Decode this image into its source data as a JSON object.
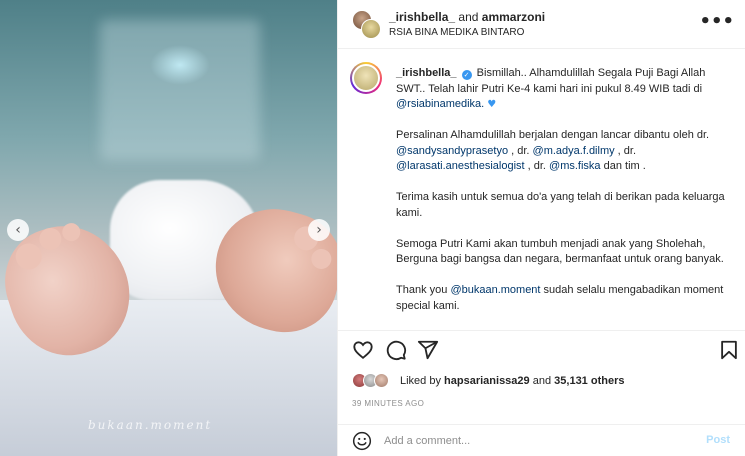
{
  "photo": {
    "watermark": "bukaan.moment",
    "nav_prev_glyph": "‹",
    "nav_next_glyph": "›"
  },
  "header": {
    "user1": "_irishbella_",
    "joiner": "and",
    "user2": "ammarzoni",
    "location": "RSIA BINA MEDIKA BINTARO",
    "more_glyph": "•••"
  },
  "caption": {
    "username": "_irishbella_",
    "verified_glyph": "✓",
    "line1_text": "Bismillah.. Alhamdulillah Segala Puji Bagi Allah SWT.. Telah lahir Putri Ke-4 kami hari ini pukul 8.49 WIB tadi di",
    "line1_mention": "@rsiabinamedika.",
    "heart_glyph": "♥",
    "p2_text": "Persalinan Alhamdulillah berjalan dengan lancar dibantu oleh dr.",
    "p2_m1": "@sandysandyprasetyo",
    "p2_sep1": ", dr.",
    "p2_m2": "@m.adya.f.dilmy",
    "p2_sep2": ", dr.",
    "p2_m3": "@larasati.anesthesialogist",
    "p2_sep3": ", dr.",
    "p2_m4": "@ms.fiska",
    "p2_end": "dan tim .",
    "p3": "Terima kasih untuk semua do'a yang telah di berikan pada keluarga kami.",
    "p4": "Semoga Putri Kami akan tumbuh menjadi anak yang Sholehah, Berguna bagi bangsa dan negara, bermanfaat untuk orang banyak.",
    "p5_start": "Thank you",
    "p5_mention": "@bukaan.moment",
    "p5_end": "sudah selalu mengabadikan moment special kami."
  },
  "likes": {
    "prefix": "Liked by",
    "first_liker": "hapsarianissa29",
    "joiner": "and",
    "count_text": "35,131 others"
  },
  "timestamp": "39 MINUTES AGO",
  "comment": {
    "placeholder": "Add a comment...",
    "post_label": "Post"
  },
  "colors": {
    "link": "#00376b",
    "verified": "#3897f0",
    "post_disabled": "#b2dffc",
    "muted": "#8e8e8e"
  }
}
